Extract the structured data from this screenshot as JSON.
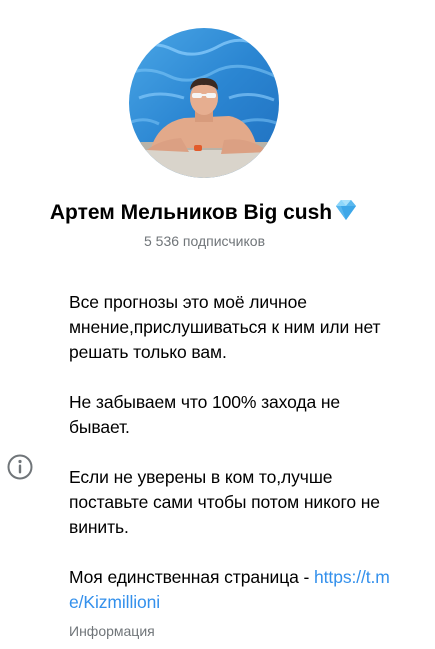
{
  "profile": {
    "name": "Артем Мельников Big cush",
    "subscribers": "5 536 подписчиков"
  },
  "about": {
    "line1": "Все прогнозы это моё личное мнение,прислушиваться к ним или нет решать только вам.",
    "line2": "Не забываем что 100% захода не бывает.",
    "line3": "Если не уверены в ком то,лучше поставьте сами чтобы потом никого не винить.",
    "line4_prefix": "Моя единственная страница - ",
    "link": "https://t.me/Kizmillioni",
    "caption": "Информация"
  },
  "icons": {
    "avatar": "profile-photo",
    "badge": "gem-icon",
    "info": "info-icon"
  },
  "colors": {
    "accent": "#3390ec",
    "secondary_text": "#707579",
    "pool_water": "#2f8fd8"
  }
}
